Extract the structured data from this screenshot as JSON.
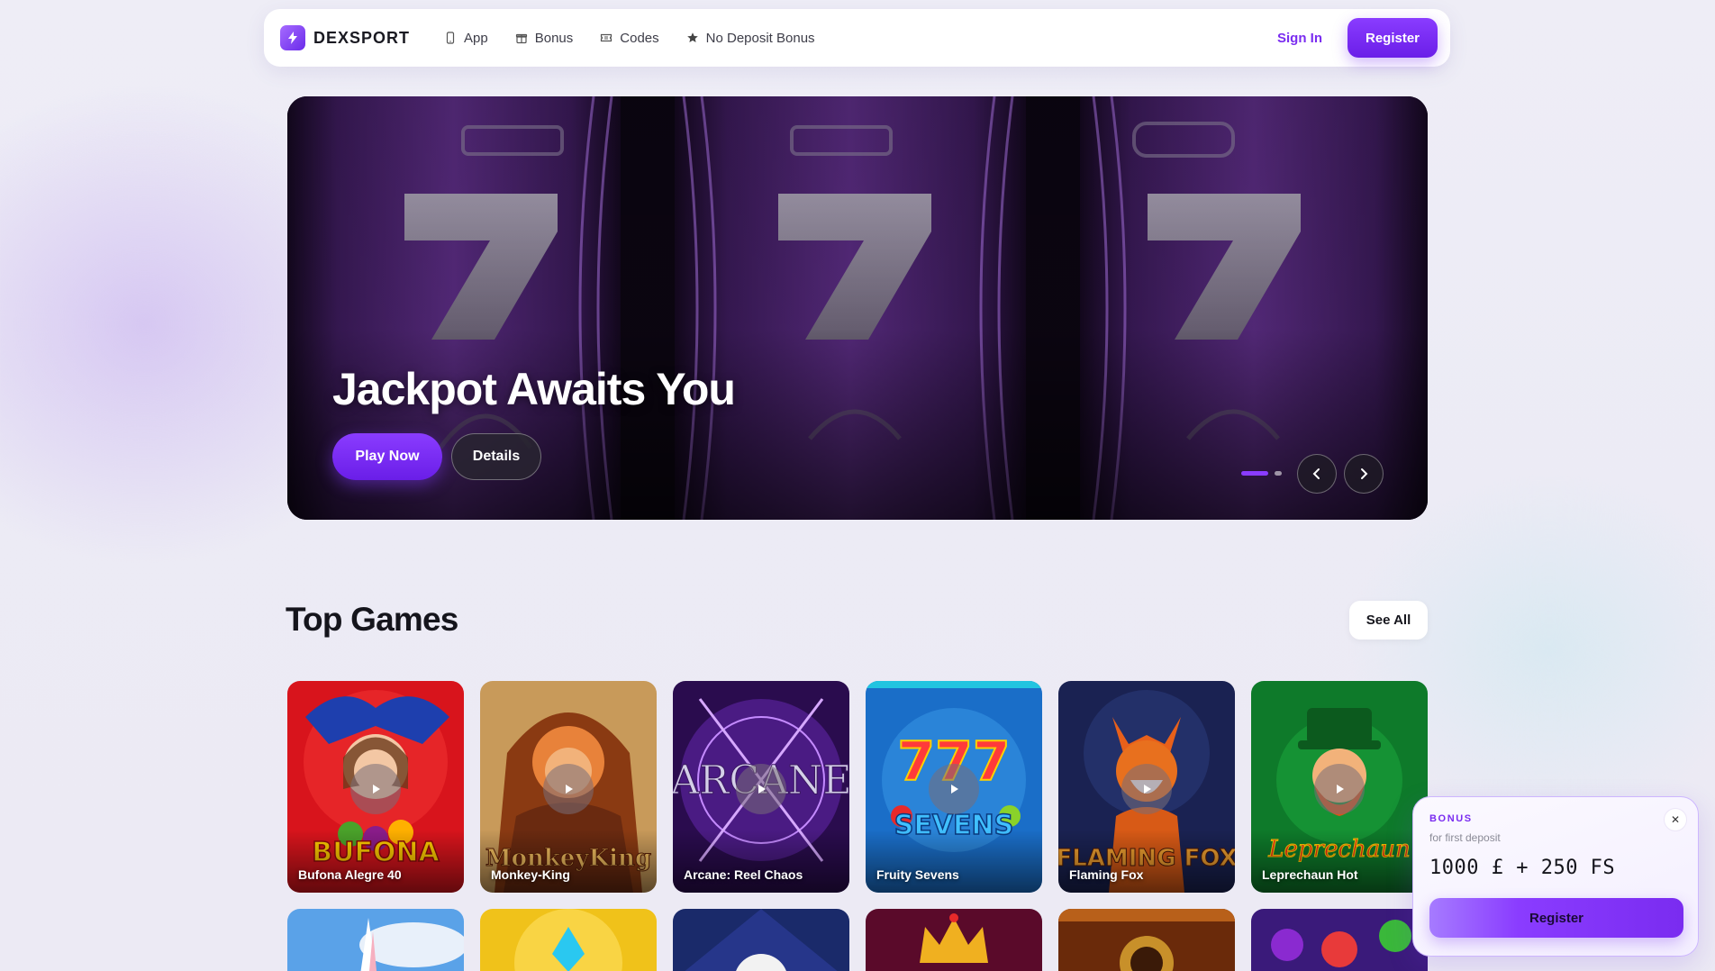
{
  "brand": {
    "name": "DEXSPORT",
    "logo_icon": "bolt-logo-icon",
    "accent": "#7a2cf0"
  },
  "nav": {
    "links": [
      {
        "label": "App",
        "icon": "phone-icon"
      },
      {
        "label": "Bonus",
        "icon": "gift-icon"
      },
      {
        "label": "Codes",
        "icon": "ticket-icon"
      },
      {
        "label": "No Deposit Bonus",
        "icon": "star-icon"
      }
    ],
    "signin_label": "Sign In",
    "register_label": "Register"
  },
  "hero": {
    "title": "Jackpot Awaits You",
    "play_label": "Play Now",
    "details_label": "Details",
    "slide_count": 2,
    "active_slide": 1
  },
  "top_games": {
    "title": "Top Games",
    "see_all_label": "See All",
    "games": [
      {
        "name": "Bufona Alegre 40"
      },
      {
        "name": "Monkey-King"
      },
      {
        "name": "Arcane: Reel Chaos"
      },
      {
        "name": "Fruity Sevens"
      },
      {
        "name": "Flaming Fox"
      },
      {
        "name": "Leprechaun Hot"
      }
    ]
  },
  "bonus_popup": {
    "label": "BONUS",
    "subtitle": "for first deposit",
    "amount": "1000 £ + 250 FS",
    "register_label": "Register",
    "close_icon": "close-icon"
  }
}
